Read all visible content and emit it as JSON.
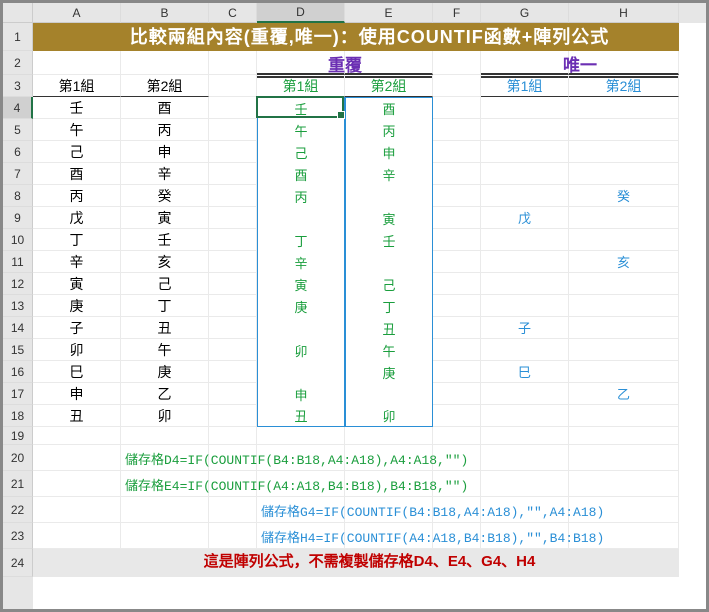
{
  "columns": [
    "A",
    "B",
    "C",
    "D",
    "E",
    "F",
    "G",
    "H"
  ],
  "rowcount": 24,
  "row_heights": {
    "1": 28,
    "2": 24,
    "3": 22,
    "4": 22,
    "5": 22,
    "6": 22,
    "7": 22,
    "8": 22,
    "9": 22,
    "10": 22,
    "11": 22,
    "12": 22,
    "13": 22,
    "14": 22,
    "15": 22,
    "16": 22,
    "17": 22,
    "18": 22,
    "19": 18,
    "20": 26,
    "21": 26,
    "22": 26,
    "23": 26,
    "24": 28
  },
  "title": "比較兩組內容(重覆,唯一)：使用COUNTIF函數+陣列公式",
  "section_dup": "重覆",
  "section_uni": "唯一",
  "hdr": {
    "g1": "第1組",
    "g2": "第2組"
  },
  "dataA": [
    "壬",
    "午",
    "己",
    "酉",
    "丙",
    "戊",
    "丁",
    "辛",
    "寅",
    "庚",
    "子",
    "卯",
    "巳",
    "申",
    "丑"
  ],
  "dataB": [
    "酉",
    "丙",
    "申",
    "辛",
    "癸",
    "寅",
    "壬",
    "亥",
    "己",
    "丁",
    "丑",
    "午",
    "庚",
    "乙",
    "卯"
  ],
  "dataD": [
    "壬",
    "午",
    "己",
    "酉",
    "丙",
    "",
    "丁",
    "辛",
    "寅",
    "庚",
    "",
    "卯",
    "",
    "申",
    "丑"
  ],
  "dataE": [
    "酉",
    "丙",
    "申",
    "辛",
    "",
    "寅",
    "壬",
    "",
    "己",
    "丁",
    "丑",
    "午",
    "庚",
    "",
    "卯"
  ],
  "dataG": [
    "",
    "",
    "",
    "",
    "",
    "戊",
    "",
    "",
    "",
    "",
    "子",
    "",
    "巳",
    "",
    ""
  ],
  "dataH": [
    "",
    "",
    "",
    "",
    "癸",
    "",
    "",
    "亥",
    "",
    "",
    "",
    "",
    "",
    "乙",
    ""
  ],
  "formula_d": "儲存格D4=IF(COUNTIF(B4:B18,A4:A18),A4:A18,\"\")",
  "formula_e": "儲存格E4=IF(COUNTIF(A4:A18,B4:B18),B4:B18,\"\")",
  "formula_g": "儲存格G4=IF(COUNTIF(B4:B18,A4:A18),\"\",A4:A18)",
  "formula_h": "儲存格H4=IF(COUNTIF(A4:A18,B4:B18),\"\",B4:B18)",
  "note": "這是陣列公式，不需複製儲存格D4、E4、G4、H4",
  "active": {
    "col": "D",
    "row": 4
  }
}
